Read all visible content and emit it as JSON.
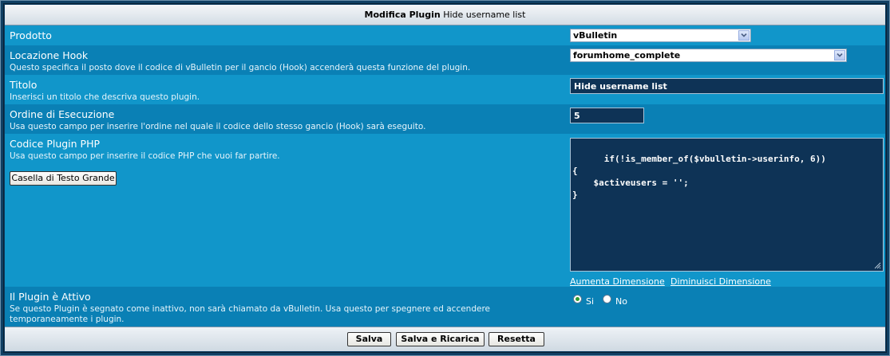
{
  "header": {
    "title_bold": "Modifica Plugin",
    "title_rest": "Hide username list"
  },
  "product": {
    "label": "Prodotto",
    "value": "vBulletin"
  },
  "hook": {
    "label": "Locazione Hook",
    "description": "Questo specifica il posto dove il codice di vBulletin per il gancio (Hook) accenderà questa funzione del plugin.",
    "value": "forumhome_complete"
  },
  "title_field": {
    "label": "Titolo",
    "description": "Inserisci un titolo che descriva questo plugin.",
    "value": "Hide username list"
  },
  "order": {
    "label": "Ordine di Esecuzione",
    "description": "Usa questo campo per inserire l'ordine nel quale il codice dello stesso gancio (Hook) sarà eseguito.",
    "value": "5"
  },
  "php": {
    "label": "Codice Plugin PHP",
    "description": "Usa questo campo per inserire il codice PHP che vuoi far partire.",
    "big_box_button": "Casella di Testo Grande",
    "code": "if(!is_member_of($vbulletin->userinfo, 6))\n{\n    $activeusers = '';\n}",
    "increase_link": "Aumenta Dimensione",
    "decrease_link": "Diminuisci Dimensione"
  },
  "active": {
    "label": "Il Plugin è Attivo",
    "description": "Se questo Plugin è segnato come inattivo, non sarà chiamato da vBulletin. Usa questo per spegnere ed accendere temporaneamente i plugin.",
    "yes_label": "Si",
    "no_label": "No",
    "selected": "Si"
  },
  "footer": {
    "save": "Salva",
    "save_reload": "Salva e Ricarica",
    "reset": "Resetta"
  }
}
